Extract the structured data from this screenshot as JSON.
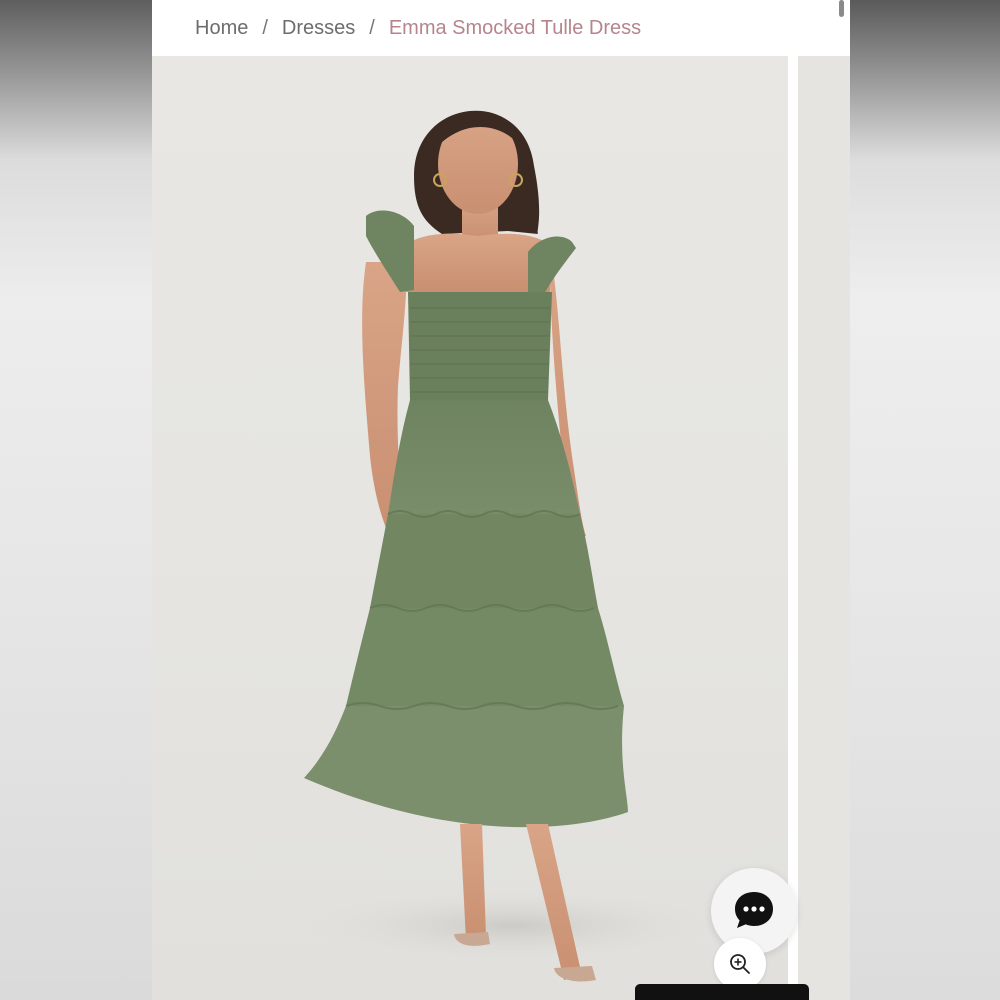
{
  "breadcrumb": {
    "home": "Home",
    "separator": "/",
    "category": "Dresses",
    "current": "Emma Smocked Tulle Dress"
  },
  "product_image": {
    "icon": "product-photo",
    "dress_color": "#6f8460"
  },
  "chat": {
    "icon": "chat-bubble-icon"
  },
  "zoom": {
    "icon": "zoom-in-icon"
  },
  "colors": {
    "accent": "#b5858c",
    "breadcrumb_text": "#6d6d6d"
  }
}
